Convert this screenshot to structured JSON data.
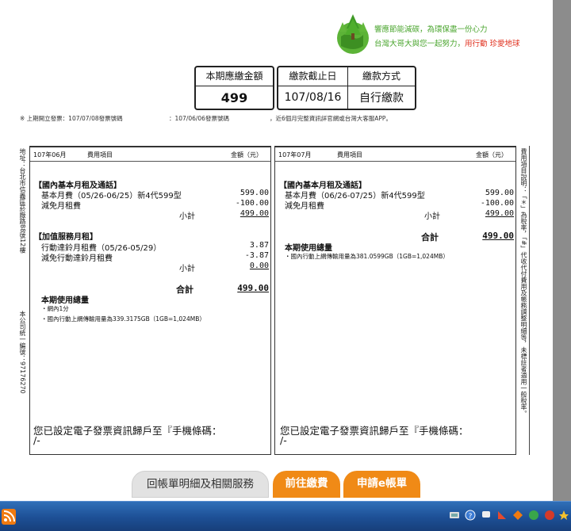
{
  "logo": {
    "slogan_line1": "響應節能減碳，為環保盡一份心力",
    "slogan_line2_a": "台灣大哥大與您一起努力，",
    "slogan_line2_b": "用行動 珍愛地球",
    "icon": "tree-globe-icon"
  },
  "summary": {
    "amount_header": "本期應繳金額",
    "amount_value": "499",
    "due_header": "繳款截止日",
    "due_value": "107/08/16",
    "method_header": "繳款方式",
    "method_value": "自行繳款"
  },
  "notice": {
    "part1": "※ 上期開立發票：107/07/08發票號碼",
    "part2": "：107/06/06發票號碼",
    "part3": "，近6個月完整資訊詳官網或台灣大客服APP。"
  },
  "side": {
    "left_top": "地址：台北市信義區菸廠路88號12樓",
    "left_bottom": "本公司統一編號：97176270",
    "right": "費用項目說明：「＊」為稅率，「#」代收代付費用及帳務調整明細等，未標註者適用一般稅率。"
  },
  "bill_left": {
    "period": "107年06月",
    "col_item": "費用項目",
    "col_amount": "金額（元）",
    "section1_title": "【國內基本月租及通話】",
    "row1_label": "基本月費（05/26-06/25）新4代599型",
    "row1_value": "599.00",
    "row2_label": "減免月租費",
    "row2_value": "-100.00",
    "subtotal1_label": "小計",
    "subtotal1_value": "499.00",
    "section2_title": "【加值服務月租】",
    "row3_label": "行動達鈴月租費（05/26-05/29）",
    "row3_value": "3.87",
    "row4_label": "減免行動達鈴月租費",
    "row4_value": "-3.87",
    "subtotal2_label": "小計",
    "subtotal2_value": "0.00",
    "total_label": "合計",
    "total_value": "499.00",
    "usage_title": "本期使用總量",
    "usage1": "・網內1分",
    "usage2": "・國內行動上網傳輸用量為339.3175GB（1GB=1,024MB）",
    "einvoice_line1": "您已設定電子發票資訊歸戶至『手機條碼：",
    "einvoice_line2": "/-"
  },
  "bill_right": {
    "period": "107年07月",
    "col_item": "費用項目",
    "col_amount": "金額（元）",
    "section1_title": "【國內基本月租及通話】",
    "row1_label": "基本月費（06/26-07/25）新4代599型",
    "row1_value": "599.00",
    "row2_label": "減免月租費",
    "row2_value": "-100.00",
    "subtotal1_label": "小計",
    "subtotal1_value": "499.00",
    "total_label": "合計",
    "total_value": "499.00",
    "usage_title": "本期使用總量",
    "usage1": "・國內行動上網傳輸用量為381.0599GB（1GB=1,024MB）",
    "einvoice_line1": "您已設定電子發票資訊歸戶至『手機條碼：",
    "einvoice_line2": "/-"
  },
  "buttons": {
    "back": "回帳單明細及相關服務",
    "pay": "前往繳費",
    "ebill": "申請e帳單"
  },
  "colors": {
    "accent_orange": "#f08a16",
    "slogan_green": "#4aa52e",
    "slogan_red": "#e0301e",
    "taskbar_blue": "#1d4f95"
  }
}
